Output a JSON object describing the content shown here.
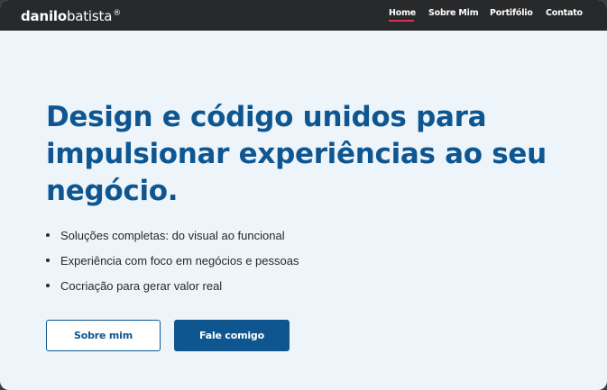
{
  "header": {
    "logo": {
      "bold": "danilo",
      "light": "batista",
      "mark": "®"
    },
    "nav": [
      {
        "label": "Home",
        "active": true
      },
      {
        "label": "Sobre Mim",
        "active": false
      },
      {
        "label": "Portifólio",
        "active": false
      },
      {
        "label": "Contato",
        "active": false
      }
    ]
  },
  "hero": {
    "title": "Design e código unidos para impulsionar experiências ao seu negócio.",
    "bullets": [
      "Soluções completas: do visual ao funcional",
      "Experiência com foco em negócios e pessoas",
      "Cocriação para gerar valor real"
    ],
    "buttons": {
      "secondary": "Sobre mim",
      "primary": "Fale comigo"
    }
  },
  "colors": {
    "navbar_bg": "#28292b",
    "page_bg": "#edf5fb",
    "brand_blue": "#0f5690",
    "active_underline": "#d6334f"
  }
}
